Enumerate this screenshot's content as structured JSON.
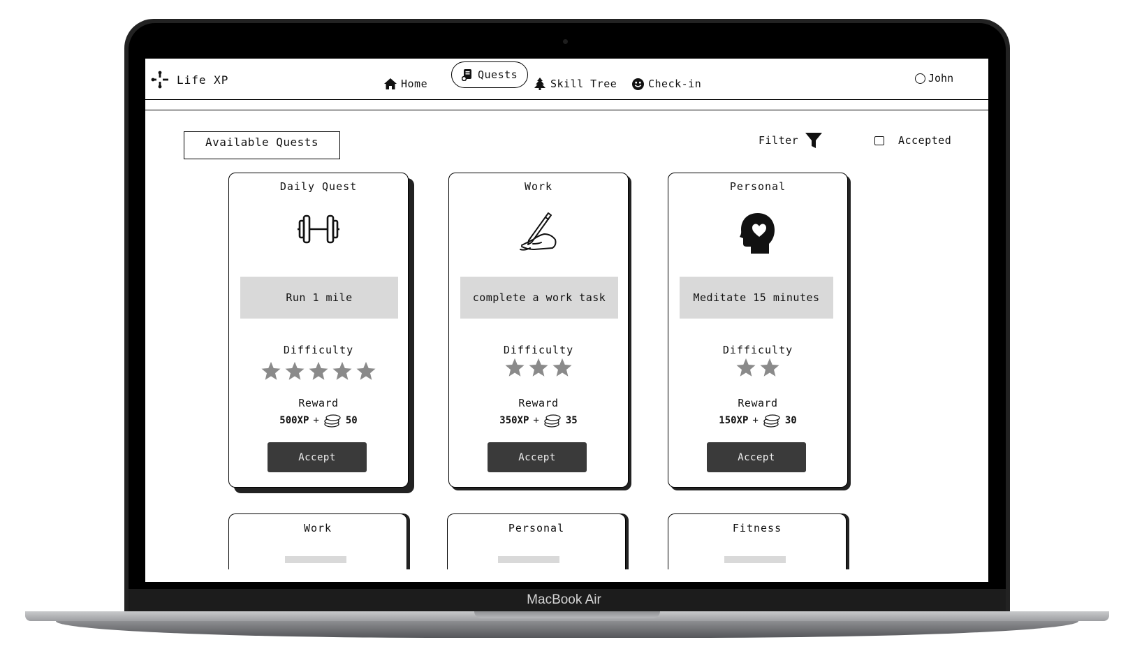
{
  "device": {
    "label": "MacBook Air"
  },
  "app": {
    "name": "Life XP"
  },
  "nav": {
    "items": [
      {
        "label": "Home",
        "icon": "home-icon"
      },
      {
        "label": "Quests",
        "icon": "scroll-icon",
        "active": true
      },
      {
        "label": "Skill Tree",
        "icon": "tree-icon"
      },
      {
        "label": "Check-in",
        "icon": "smiley-icon"
      }
    ],
    "user": "John"
  },
  "toolbar": {
    "available_label": "Available Quests",
    "filter_label": "Filter",
    "accepted_label": "Accepted",
    "accepted_checked": false
  },
  "cards": [
    {
      "category": "Daily Quest",
      "icon": "dumbbell-icon",
      "task": "Run 1 mile",
      "difficulty_label": "Difficulty",
      "difficulty": 5,
      "reward_label": "Reward",
      "xp": "500XP",
      "plus": "+",
      "coins": "50",
      "button": "Accept"
    },
    {
      "category": "Work",
      "icon": "writing-hand-icon",
      "task": "complete a work task",
      "difficulty_label": "Difficulty",
      "difficulty": 3,
      "reward_label": "Reward",
      "xp": "350XP",
      "plus": "+",
      "coins": "35",
      "button": "Accept"
    },
    {
      "category": "Personal",
      "icon": "heart-head-icon",
      "task": "Meditate 15 minutes",
      "difficulty_label": "Difficulty",
      "difficulty": 2,
      "reward_label": "Reward",
      "xp": "150XP",
      "plus": "+",
      "coins": "30",
      "button": "Accept"
    }
  ],
  "next_cards": [
    {
      "category": "Work"
    },
    {
      "category": "Personal"
    },
    {
      "category": "Fitness"
    }
  ],
  "colors": {
    "star": "#8a8a8a",
    "button": "#3a3a3a",
    "task_bg": "#d9d9d9"
  }
}
